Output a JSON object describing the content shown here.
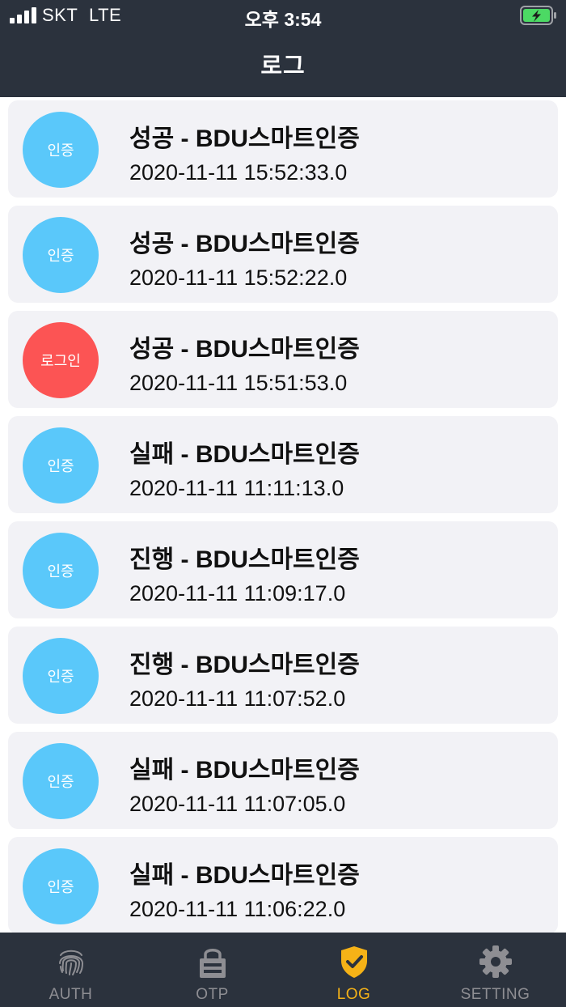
{
  "status_bar": {
    "carrier": "SKT",
    "network": "LTE",
    "time": "오후 3:54"
  },
  "header": {
    "title": "로그"
  },
  "log_entries": [
    {
      "badge": "인증",
      "badge_type": "auth",
      "title": "성공 - BDU스마트인증",
      "timestamp": "2020-11-11 15:52:33.0"
    },
    {
      "badge": "인증",
      "badge_type": "auth",
      "title": "성공 - BDU스마트인증",
      "timestamp": "2020-11-11 15:52:22.0"
    },
    {
      "badge": "로그인",
      "badge_type": "login",
      "title": "성공 - BDU스마트인증",
      "timestamp": "2020-11-11 15:51:53.0"
    },
    {
      "badge": "인증",
      "badge_type": "auth",
      "title": "실패 - BDU스마트인증",
      "timestamp": "2020-11-11 11:11:13.0"
    },
    {
      "badge": "인증",
      "badge_type": "auth",
      "title": "진행 - BDU스마트인증",
      "timestamp": "2020-11-11 11:09:17.0"
    },
    {
      "badge": "인증",
      "badge_type": "auth",
      "title": "진행 - BDU스마트인증",
      "timestamp": "2020-11-11 11:07:52.0"
    },
    {
      "badge": "인증",
      "badge_type": "auth",
      "title": "실패 - BDU스마트인증",
      "timestamp": "2020-11-11 11:07:05.0"
    },
    {
      "badge": "인증",
      "badge_type": "auth",
      "title": "실패 - BDU스마트인증",
      "timestamp": "2020-11-11 11:06:22.0"
    }
  ],
  "tabs": [
    {
      "label": "AUTH",
      "icon": "fingerprint-icon",
      "active": false
    },
    {
      "label": "OTP",
      "icon": "lock-icon",
      "active": false
    },
    {
      "label": "LOG",
      "icon": "shield-check-icon",
      "active": true
    },
    {
      "label": "SETTING",
      "icon": "gear-icon",
      "active": false
    }
  ],
  "colors": {
    "bar_background": "#2b323d",
    "auth_badge": "#5ac8fa",
    "login_badge": "#fc5454",
    "active_tab": "#f5b217",
    "inactive_tab": "#8e8e93",
    "card_background": "#f2f2f6"
  }
}
